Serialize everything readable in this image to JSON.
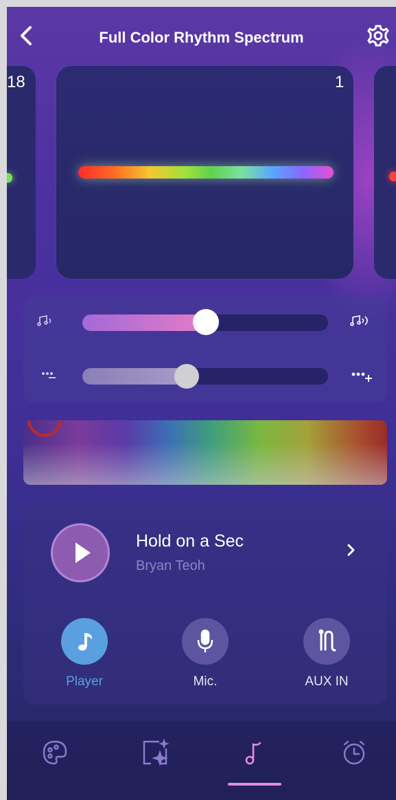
{
  "header": {
    "title": "Full Color Rhythm Spectrum",
    "back_icon": "chevron-left-icon",
    "settings_icon": "gear-icon"
  },
  "carousel": {
    "left_card_number": "18",
    "main_card_number": "1",
    "spectrum_colors": [
      "#ff2b2b",
      "#f4c732",
      "#5fd24d",
      "#5aa7ff",
      "#e94fd1"
    ]
  },
  "sliders": {
    "sensitivity": {
      "low_icon": "music-note-quiet-icon",
      "high_icon": "music-note-loud-icon",
      "value": 0.47
    },
    "speed": {
      "low_icon": "dots-minus-icon",
      "high_icon": "dots-plus-icon",
      "value": 0.39
    }
  },
  "now_playing": {
    "song": "Hold on a Sec",
    "artist": "Bryan Teoh"
  },
  "modes": [
    {
      "label": "Player",
      "icon": "music-note-icon",
      "active": true
    },
    {
      "label": "Mic.",
      "icon": "microphone-icon",
      "active": false
    },
    {
      "label": "AUX IN",
      "icon": "aux-cable-icon",
      "active": false
    }
  ],
  "tabs": [
    {
      "icon": "palette-icon",
      "active": false
    },
    {
      "icon": "scene-sparkle-icon",
      "active": false
    },
    {
      "icon": "music-note-icon",
      "active": true
    },
    {
      "icon": "alarm-clock-icon",
      "active": false
    }
  ],
  "colors": {
    "accent_pink": "#e47bc6",
    "active_blue": "#5aa0e0",
    "background": "#3e2f96"
  }
}
